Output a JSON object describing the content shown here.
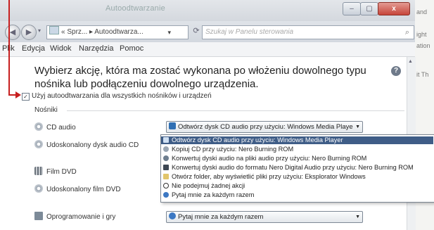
{
  "background_window": {
    "texts": [
      "and",
      "ight",
      "ation",
      "it Th"
    ]
  },
  "window": {
    "title": "Autoodtwarzanie",
    "buttons": {
      "minimize": "–",
      "maximize": "▢",
      "close": "x"
    }
  },
  "nav": {
    "address": "« Sprz... ▸ Autoodtwarza...",
    "search_placeholder": "Szukaj w Panelu sterowania"
  },
  "menu": [
    "Plik",
    "Edycja",
    "Widok",
    "Narzędzia",
    "Pomoc"
  ],
  "content": {
    "heading": "Wybierz akcję, która ma zostać wykonana po włożeniu dowolnego typu nośnika lub podłączeniu dowolnego urządzenia.",
    "autoplay_checkbox": {
      "label": "Użyj autoodtwarzania dla wszystkich nośników i urządzeń",
      "checked": true
    },
    "section_title": "Nośniki",
    "media": [
      {
        "label": "CD audio",
        "icon": "cd-icon"
      },
      {
        "label": "Udoskonalony dysk audio CD",
        "icon": "cd-icon"
      },
      {
        "label": "Film DVD",
        "icon": "film-icon"
      },
      {
        "label": "Udoskonalony film DVD",
        "icon": "cd-icon"
      },
      {
        "label": "Oprogramowanie i gry",
        "icon": "software-icon"
      }
    ],
    "selects": {
      "cd_audio": "Odtwórz dysk CD audio przy użyciu: Windows Media Playe",
      "software": "Pytaj mnie za każdym razem"
    },
    "dropdown_options": [
      "Odtwórz dysk CD audio przy użyciu: Windows Media Player",
      "Kopiuj CD przy użyciu: Nero Burning ROM",
      "Konwertuj dyski audio na pliki audio przy użyciu: Nero Burning ROM",
      "Konwertuj dyski audio do formatu Nero Digital Audio przy użyciu: Nero Burning ROM",
      "Otwórz folder, aby wyświetlić pliki przy użyciu: Eksplorator Windows",
      "Nie podejmuj żadnej akcji",
      "Pytaj mnie za każdym razem"
    ]
  },
  "colors": {
    "annotation_arrow": "#c71f1f",
    "selected_option": "#3f5d87"
  }
}
